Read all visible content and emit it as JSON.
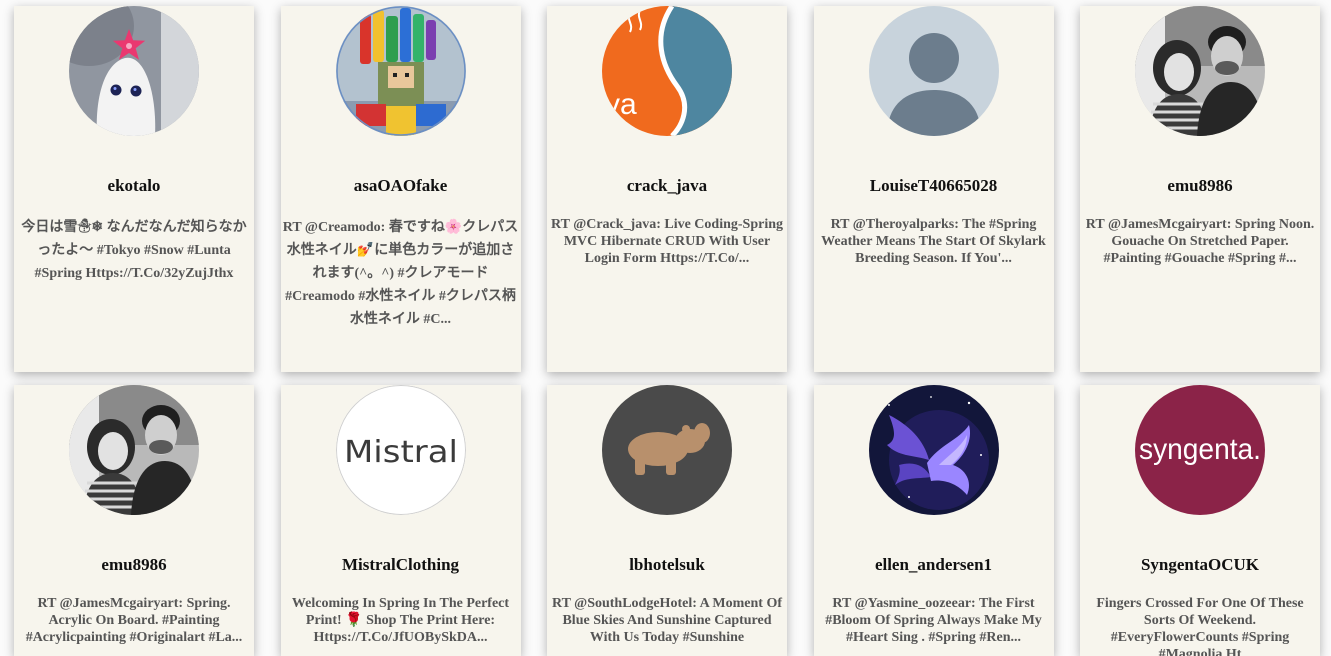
{
  "colors": {
    "page_background": "#fbfbfb",
    "card_background": "#f7f5ed",
    "username": "#111111",
    "tweet_text": "#555555"
  },
  "cards": [
    {
      "username": "ekotalo",
      "text": "今日は雪☃❄ なんだなんだ知らなかったよ〜 #Tokyo #Snow #Lunta #Spring Https://T.Co/32yZujJthx"
    },
    {
      "username": "asaOAOfake",
      "text": "RT @Creamodo: 春ですね🌸クレパス水性ネイル💅に単色カラーが追加されます(^。^) #クレアモード #Creamodo #水性ネイル #クレパス柄水性ネイル #C..."
    },
    {
      "username": "crack_java",
      "text": "RT @Crack_java: Live Coding-Spring MVC Hibernate CRUD With User Login Form Https://T.Co/...",
      "avatar_text": "va"
    },
    {
      "username": "LouiseT40665028",
      "text": "RT @Theroyalparks: The #Spring Weather Means The Start Of Skylark Breeding Season. If You'..."
    },
    {
      "username": "emu8986",
      "text": "RT @JamesMcgairyart: Spring Noon. Gouache On Stretched Paper. #Painting #Gouache #Spring #..."
    },
    {
      "username": "emu8986",
      "text": "RT @JamesMcgairyart: Spring. Acrylic On Board. #Painting #Acrylicpainting #Originalart #La..."
    },
    {
      "username": "MistralClothing",
      "text": "Welcoming In Spring In The Perfect Print! 🌹 Shop The Print Here: Https://T.Co/JfUOBySkDA...",
      "avatar_text": "Mistral"
    },
    {
      "username": "lbhotelsuk",
      "text": "RT @SouthLodgeHotel: A Moment Of Blue Skies And Sunshine Captured With Us Today #Sunshine"
    },
    {
      "username": "ellen_andersen1",
      "text": "RT @Yasmine_oozeear: The First #Bloom Of Spring Always Make My #Heart Sing . #Spring #Ren..."
    },
    {
      "username": "SyngentaOCUK",
      "text": "Fingers Crossed For One Of These Sorts Of Weekend. #EveryFlowerCounts #Spring #Magnolia Ht",
      "avatar_text": "syngenta."
    }
  ]
}
